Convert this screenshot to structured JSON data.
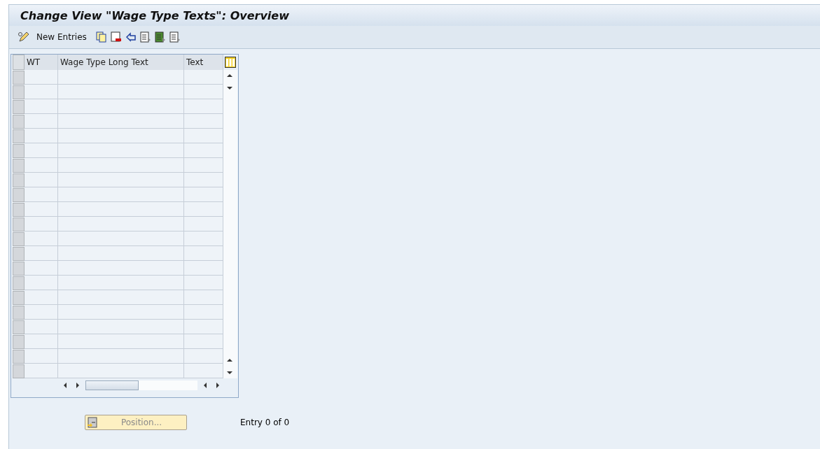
{
  "window": {
    "title": "Change View \"Wage Type Texts\": Overview"
  },
  "toolbar": {
    "new_entries": "New Entries"
  },
  "table": {
    "columns": [
      "WT",
      "Wage Type Long Text",
      "Text"
    ]
  },
  "position_button": "Position...",
  "entry_count": "Entry 0 of 0"
}
